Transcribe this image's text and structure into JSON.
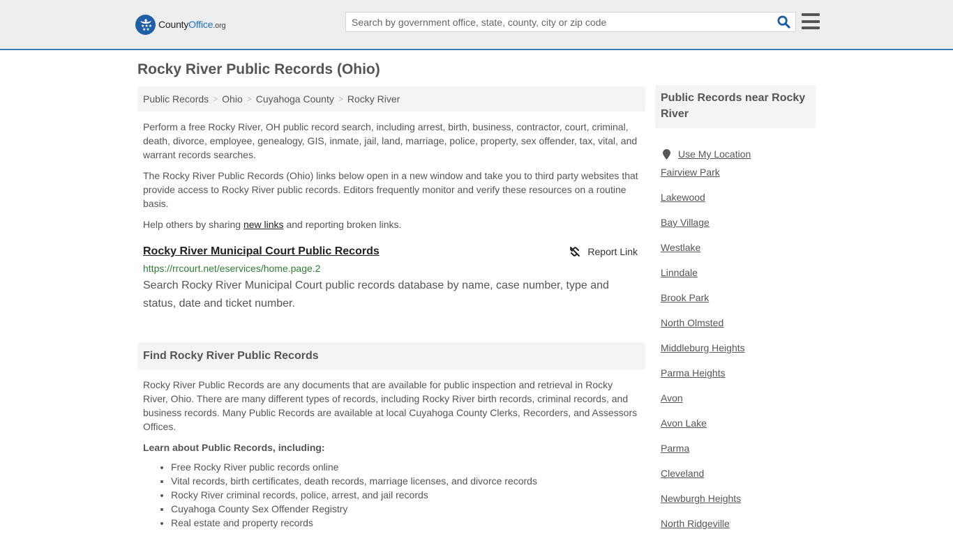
{
  "header": {
    "logo": {
      "name": "County",
      "name_accent": "Office",
      "tld": ".org"
    },
    "search": {
      "placeholder": "Search by government office, state, county, city or zip code",
      "value": ""
    },
    "icons": {
      "search": "search-icon",
      "menu": "hamburger-menu-icon",
      "logo": "eagle-stars-badge-icon"
    }
  },
  "page": {
    "title": "Rocky River Public Records (Ohio)"
  },
  "breadcrumb": [
    {
      "label": "Public Records"
    },
    {
      "label": "Ohio"
    },
    {
      "label": "Cuyahoga County"
    },
    {
      "label": "Rocky River"
    }
  ],
  "breadcrumb_separator": ">",
  "intro": {
    "p1": "Perform a free Rocky River, OH public record search, including arrest, birth, business, contractor, court, criminal, death, divorce, employee, genealogy, GIS, inmate, jail, land, marriage, police, property, sex offender, tax, vital, and warrant records searches.",
    "p2": "The Rocky River Public Records (Ohio) links below open in a new window and take you to third party websites that provide access to Rocky River public records. Editors frequently monitor and verify these resources on a routine basis.",
    "p3_before": "Help others by sharing ",
    "p3_link": "new links",
    "p3_after": " and reporting broken links."
  },
  "records": [
    {
      "title": "Rocky River Municipal Court Public Records",
      "url": "https://rrcourt.net/eservices/home.page.2",
      "description": "Search Rocky River Municipal Court public records database by name, case number, type and status, date and ticket number.",
      "report_label": "Report Link"
    }
  ],
  "find_section": {
    "heading": "Find Rocky River Public Records",
    "body": "Rocky River Public Records are any documents that are available for public inspection and retrieval in Rocky River, Ohio. There are many different types of records, including Rocky River birth records, criminal records, and business records. Many Public Records are available at local Cuyahoga County Clerks, Recorders, and Assessors Offices.",
    "learn_heading": "Learn about Public Records, including:",
    "learn_items": [
      "Free Rocky River public records online",
      "Vital records, birth certificates, death records, marriage licenses, and divorce records",
      "Rocky River criminal records, police, arrest, and jail records",
      "Cuyahoga County Sex Offender Registry",
      "Real estate and property records"
    ]
  },
  "sidebar": {
    "heading": "Public Records near Rocky River",
    "use_location": "Use My Location",
    "places": [
      "Fairview Park",
      "Lakewood",
      "Bay Village",
      "Westlake",
      "Linndale",
      "Brook Park",
      "North Olmsted",
      "Middleburg Heights",
      "Parma Heights",
      "Avon",
      "Avon Lake",
      "Parma",
      "Cleveland",
      "Newburgh Heights",
      "North Ridgeville"
    ]
  },
  "colors": {
    "brand_blue": "#1f5fa8",
    "header_bg": "#eeeeee",
    "header_border": "#3a7bb0",
    "url_green": "#2e7d32",
    "panel_bg": "#f4f4f4",
    "text": "#555555"
  }
}
